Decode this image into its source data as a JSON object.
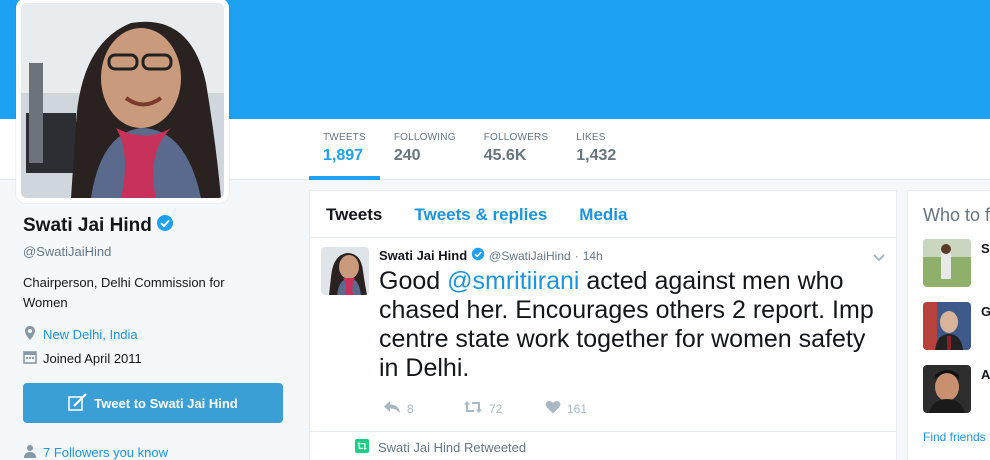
{
  "profile": {
    "name": "Swati Jai Hind",
    "handle": "@SwatiJaiHind",
    "bio": "Chairperson, Delhi Commission for Women",
    "location": "New Delhi, India",
    "joined": "Joined April 2011",
    "tweet_to_label": "Tweet to Swati Jai Hind",
    "followers_you_know": "7 Followers you know"
  },
  "stats": [
    {
      "label": "TWEETS",
      "value": "1,897"
    },
    {
      "label": "FOLLOWING",
      "value": "240"
    },
    {
      "label": "FOLLOWERS",
      "value": "45.6K"
    },
    {
      "label": "LIKES",
      "value": "1,432"
    }
  ],
  "tabs": [
    {
      "label": "Tweets"
    },
    {
      "label": "Tweets & replies"
    },
    {
      "label": "Media"
    }
  ],
  "tweet": {
    "name": "Swati Jai Hind",
    "handle": "@SwatiJaiHind",
    "dot": "·",
    "time": "14h",
    "text_before": "Good ",
    "mention": "@smritiirani",
    "text_after": " acted against men who chased her. Encourages others 2 report. Imp centre state work together for women safety in Delhi.",
    "replies": "8",
    "retweets": "72",
    "likes": "161"
  },
  "retweet_notice": "Swati Jai Hind Retweeted",
  "who_to_follow": {
    "title": "Who to f",
    "letters": [
      "S",
      "G",
      "A"
    ],
    "find_friends": "Find friends"
  },
  "colors": {
    "banner": "#1da1f2",
    "link": "#1b95e0",
    "button": "#3a9fd5",
    "retweet_green": "#19cf86"
  },
  "icons": [
    "verified-icon",
    "location-icon",
    "calendar-icon",
    "quill-icon",
    "person-icon",
    "reply-icon",
    "retweet-icon",
    "heart-icon",
    "chevron-down-icon"
  ]
}
